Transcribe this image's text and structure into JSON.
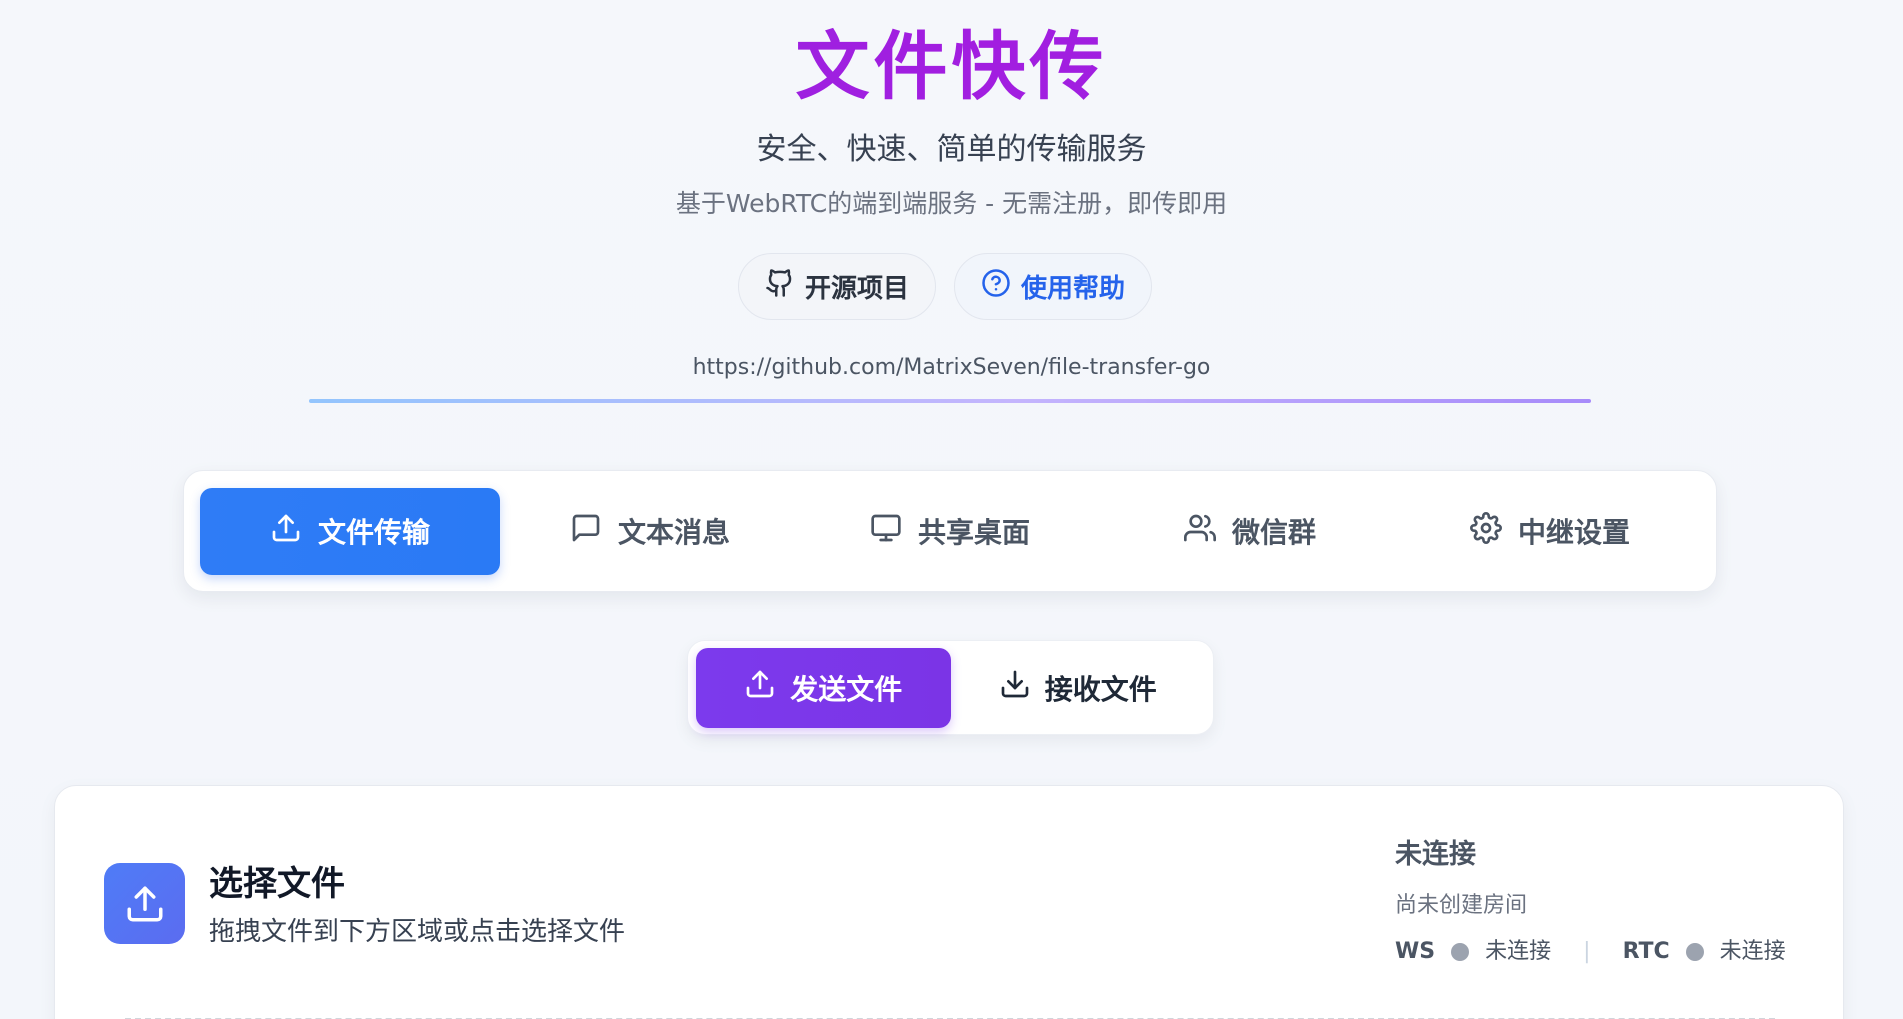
{
  "header": {
    "title": "文件快传",
    "subtitle": "安全、快速、简单的传输服务",
    "description": "基于WebRTC的端到端服务 - 无需注册，即传即用",
    "links": [
      {
        "label": "开源项目",
        "icon": "github-icon"
      },
      {
        "label": "使用帮助",
        "icon": "help-circle-icon"
      }
    ],
    "repo_url": "https://github.com/MatrixSeven/file-transfer-go"
  },
  "tabs": [
    {
      "label": "文件传输",
      "icon": "upload-icon",
      "active": true
    },
    {
      "label": "文本消息",
      "icon": "message-icon",
      "active": false
    },
    {
      "label": "共享桌面",
      "icon": "monitor-icon",
      "active": false
    },
    {
      "label": "微信群",
      "icon": "users-icon",
      "active": false
    },
    {
      "label": "中继设置",
      "icon": "gear-icon",
      "active": false
    }
  ],
  "mode": {
    "send_label": "发送文件",
    "receive_label": "接收文件",
    "active": "send"
  },
  "card": {
    "title": "选择文件",
    "subtitle": "拖拽文件到下方区域或点击选择文件",
    "status": {
      "title": "未连接",
      "room": "尚未创建房间",
      "ws_label": "WS",
      "ws_state": "未连接",
      "separator": "|",
      "rtc_label": "RTC",
      "rtc_state": "未连接"
    }
  },
  "colors": {
    "title_purple": "#9b1ee3",
    "tab_active_blue": "#2f7cf6",
    "send_active_purple": "#7c3aed",
    "status_dot_gray": "#9ca3af"
  }
}
